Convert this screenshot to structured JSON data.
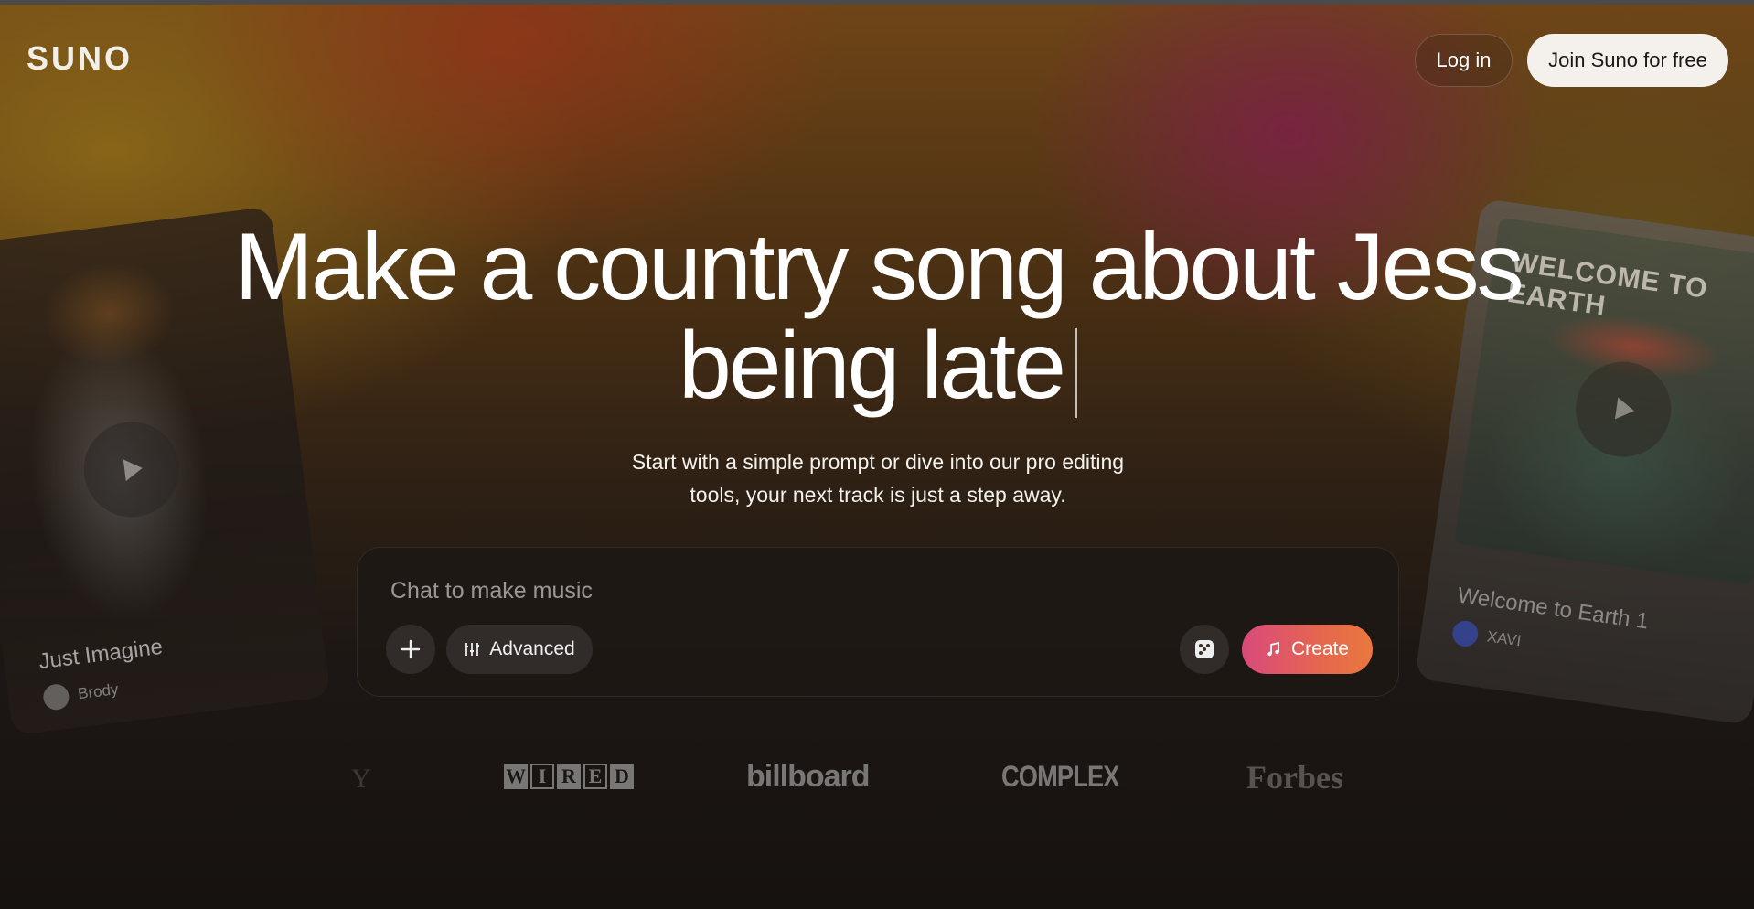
{
  "header": {
    "logo": "SUNO",
    "login_label": "Log in",
    "join_label": "Join Suno for free"
  },
  "hero": {
    "headline_line1": "Make a country song about Jess",
    "headline_line2": "being late",
    "subhead_line1": "Start with a simple prompt or dive into our pro editing",
    "subhead_line2": "tools, your next track is just a step away."
  },
  "cards": {
    "left": {
      "title": "Just Imagine",
      "artist": "Brody"
    },
    "right": {
      "art_text": "WELCOME TO EARTH",
      "title": "Welcome to Earth 1",
      "artist": "XAVI"
    }
  },
  "prompt": {
    "placeholder": "Chat to make music",
    "value": "",
    "advanced_label": "Advanced",
    "create_label": "Create"
  },
  "press": {
    "faded": "Y",
    "wired": [
      "W",
      "I",
      "R",
      "E",
      "D"
    ],
    "billboard": "billboard",
    "complex": "COMPLEX",
    "forbes": "Forbes"
  },
  "colors": {
    "create_gradient_start": "#d94a7c",
    "create_gradient_end": "#e9783e",
    "join_button_bg": "#f4f1ec"
  },
  "icons": {
    "plus": "plus-icon",
    "advanced": "sliders-icon",
    "dice": "dice-icon",
    "create": "music-note-icon",
    "play": "play-icon"
  }
}
